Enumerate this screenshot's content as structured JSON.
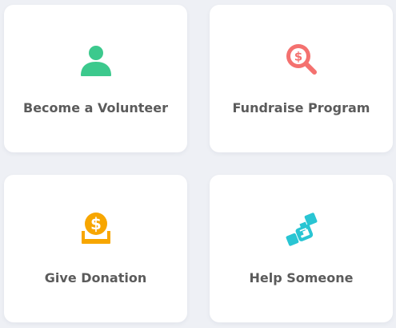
{
  "cards": [
    {
      "label": "Become a Volunteer",
      "icon": "volunteer-person-icon",
      "color": "#3cc98d"
    },
    {
      "label": "Fundraise Program",
      "icon": "fundraise-magnifier-dollar-icon",
      "color": "#f4716f"
    },
    {
      "label": "Give Donation",
      "icon": "donation-coin-icon",
      "color": "#f7a600"
    },
    {
      "label": "Help Someone",
      "icon": "handshake-icon",
      "color": "#29c5d3"
    }
  ]
}
